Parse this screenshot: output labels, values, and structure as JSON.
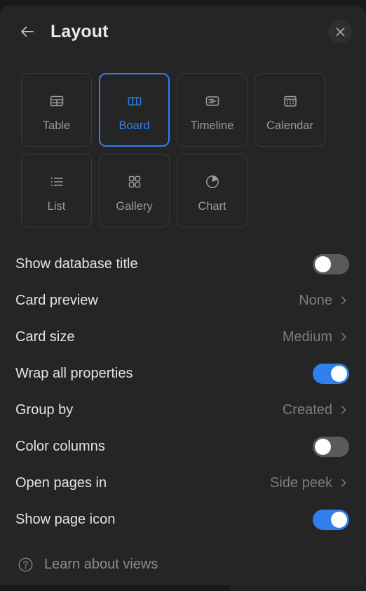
{
  "header": {
    "title": "Layout",
    "back_icon": "arrow-left-icon",
    "close_icon": "close-icon"
  },
  "layouts": {
    "selected": "Board",
    "accent_color": "#2f80ed",
    "options": [
      {
        "label": "Table",
        "icon": "table-icon",
        "selected": false
      },
      {
        "label": "Board",
        "icon": "board-icon",
        "selected": true
      },
      {
        "label": "Timeline",
        "icon": "timeline-icon",
        "selected": false
      },
      {
        "label": "Calendar",
        "icon": "calendar-icon",
        "selected": false
      },
      {
        "label": "List",
        "icon": "list-icon",
        "selected": false
      },
      {
        "label": "Gallery",
        "icon": "gallery-icon",
        "selected": false
      },
      {
        "label": "Chart",
        "icon": "chart-pie-icon",
        "selected": false
      }
    ]
  },
  "settings": {
    "rows": [
      {
        "label": "Show database title",
        "type": "toggle",
        "value": "off"
      },
      {
        "label": "Card preview",
        "type": "select",
        "value": "None"
      },
      {
        "label": "Card size",
        "type": "select",
        "value": "Medium"
      },
      {
        "label": "Wrap all properties",
        "type": "toggle",
        "value": "on"
      },
      {
        "label": "Group by",
        "type": "select",
        "value": "Created"
      },
      {
        "label": "Color columns",
        "type": "toggle",
        "value": "off"
      },
      {
        "label": "Open pages in",
        "type": "select",
        "value": "Side peek"
      },
      {
        "label": "Show page icon",
        "type": "toggle",
        "value": "on"
      }
    ]
  },
  "footer": {
    "label": "Learn about views",
    "icon": "question-circle-icon"
  }
}
